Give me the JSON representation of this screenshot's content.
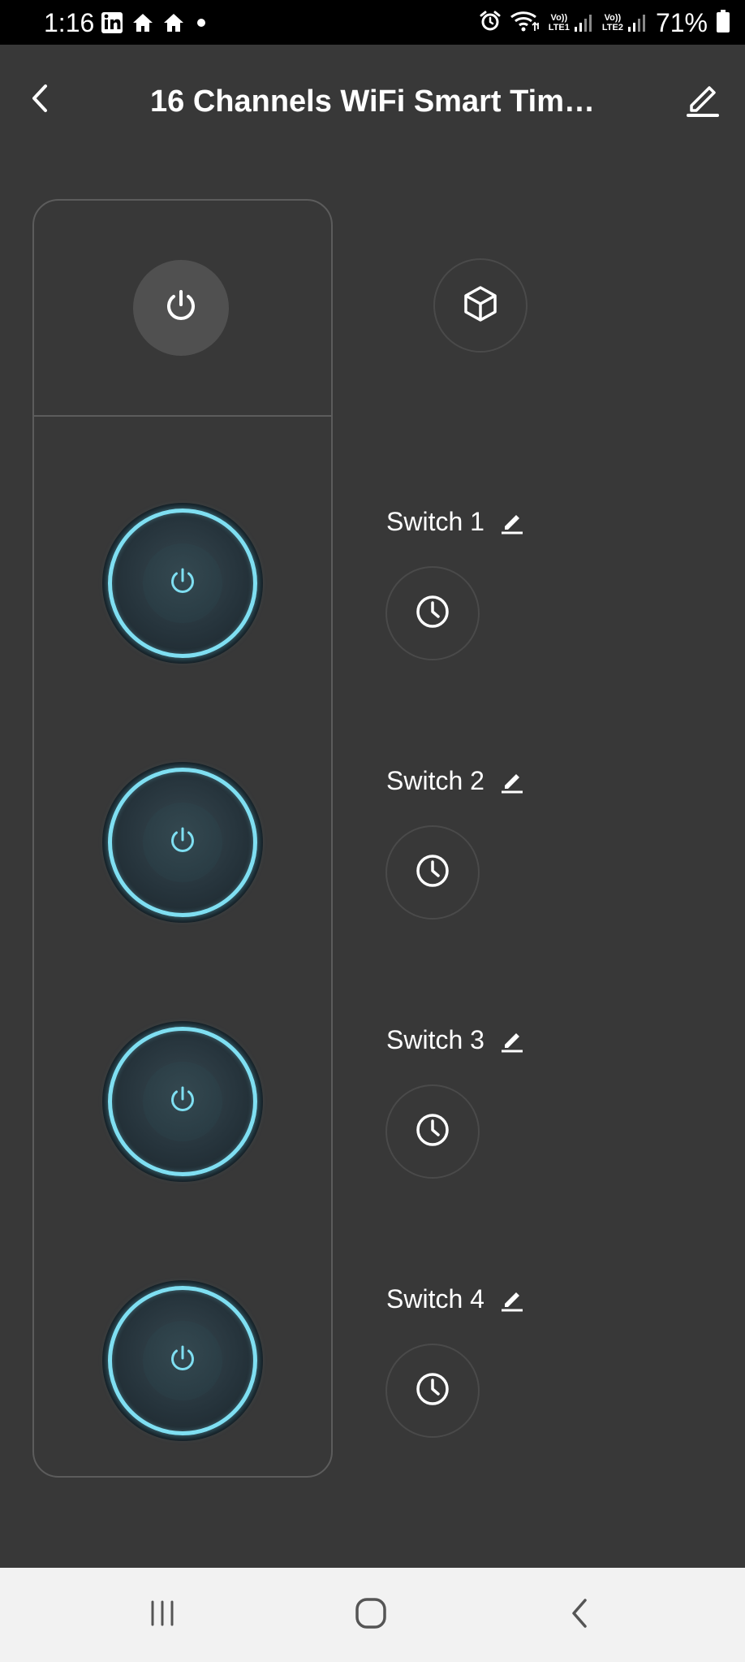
{
  "status_bar": {
    "time": "1:16",
    "left_icons": [
      "linkedin-icon",
      "home-icon",
      "home-icon",
      "notification-dot-icon"
    ],
    "right_icons": [
      "alarm-icon",
      "wifi-icon",
      "lte1-signal-icon",
      "lte2-signal-icon",
      "battery-icon"
    ],
    "lte1_top": "Vo))",
    "lte1_bottom": "LTE1",
    "lte2_top": "Vo))",
    "lte2_bottom": "LTE2",
    "battery": "71%"
  },
  "header": {
    "title": "16 Channels WiFi Smart Tim…",
    "back_icon": "chevron-left-icon",
    "edit_icon": "pencil-icon"
  },
  "panel": {
    "master_icon": "power-icon",
    "scene_icon": "cube-icon"
  },
  "switches": [
    {
      "label": "Switch 1",
      "state": "on"
    },
    {
      "label": "Switch 2",
      "state": "on"
    },
    {
      "label": "Switch 3",
      "state": "on"
    },
    {
      "label": "Switch 4",
      "state": "on"
    }
  ],
  "colors": {
    "background": "#383838",
    "accent_ring": "#7fdff2",
    "status_bar": "#000000",
    "nav_bar": "#f2f2f2"
  },
  "nav_bar": {
    "icons": [
      "recent-apps-icon",
      "home-circle-icon",
      "back-icon"
    ]
  }
}
